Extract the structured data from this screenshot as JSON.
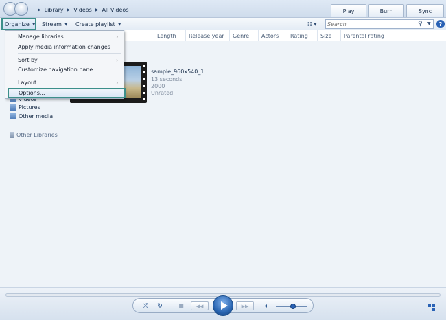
{
  "breadcrumb": [
    "Library",
    "Videos",
    "All Videos"
  ],
  "tabs": {
    "play": "Play",
    "burn": "Burn",
    "sync": "Sync"
  },
  "toolbar": {
    "organize": "Organize",
    "stream": "Stream",
    "create_playlist": "Create playlist",
    "search_placeholder": "Search"
  },
  "columns": [
    "Length",
    "Release year",
    "Genre",
    "Actors",
    "Rating",
    "Size",
    "Parental rating"
  ],
  "organize_menu": {
    "items": [
      {
        "label": "Manage libraries",
        "submenu": true
      },
      {
        "label": "Apply media information changes",
        "submenu": false
      },
      {
        "label": "Sort by",
        "submenu": true
      },
      {
        "label": "Customize navigation pane...",
        "submenu": false
      },
      {
        "label": "Layout",
        "submenu": true
      },
      {
        "label": "Options...",
        "submenu": false
      }
    ],
    "highlighted": "Options..."
  },
  "sidebar": {
    "items": [
      "Videos",
      "Pictures",
      "Other media"
    ],
    "other_libraries": "Other Libraries"
  },
  "media": {
    "title": "sample_960x540_1",
    "duration": "13 seconds",
    "year": "2000",
    "rating": "Unrated"
  },
  "player": {
    "volume_level": 0.55,
    "repeat_active": true
  },
  "colors": {
    "accent": "#2a62b5",
    "highlight_border": "#3c8f8a"
  }
}
